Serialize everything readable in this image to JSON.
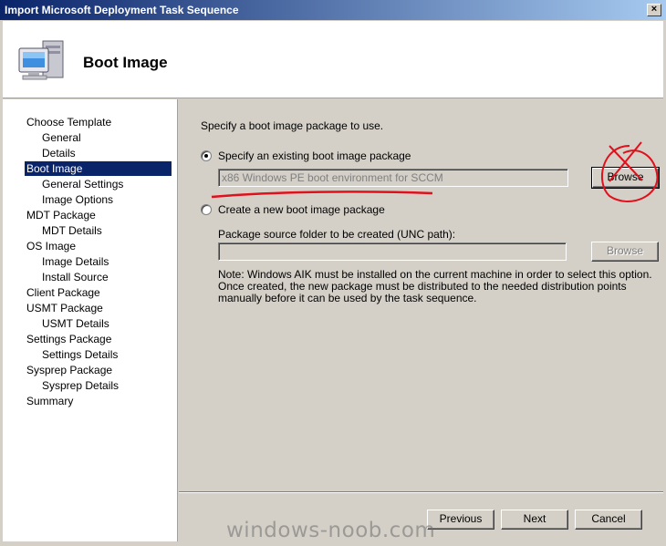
{
  "window": {
    "title": "Import Microsoft Deployment Task Sequence",
    "close_glyph": "×"
  },
  "header": {
    "title": "Boot Image",
    "icon": "computer-icon"
  },
  "nav": {
    "items": [
      {
        "label": "Choose Template",
        "level": 0
      },
      {
        "label": "General",
        "level": 1
      },
      {
        "label": "Details",
        "level": 1
      },
      {
        "label": "Boot Image",
        "level": 0,
        "selected": true
      },
      {
        "label": "General Settings",
        "level": 1
      },
      {
        "label": "Image Options",
        "level": 1
      },
      {
        "label": "MDT Package",
        "level": 0
      },
      {
        "label": "MDT Details",
        "level": 1
      },
      {
        "label": "OS Image",
        "level": 0
      },
      {
        "label": "Image Details",
        "level": 1
      },
      {
        "label": "Install Source",
        "level": 1
      },
      {
        "label": "Client Package",
        "level": 0
      },
      {
        "label": "USMT Package",
        "level": 0
      },
      {
        "label": "USMT Details",
        "level": 1
      },
      {
        "label": "Settings Package",
        "level": 0
      },
      {
        "label": "Settings Details",
        "level": 1
      },
      {
        "label": "Sysprep Package",
        "level": 0
      },
      {
        "label": "Sysprep Details",
        "level": 1
      },
      {
        "label": "Summary",
        "level": 0
      }
    ]
  },
  "content": {
    "prompt": "Specify a boot image package to use.",
    "option_existing": {
      "label": "Specify an existing boot image package",
      "checked": true
    },
    "existing_value": "x86 Windows PE boot environment for SCCM",
    "browse_existing": "Browse",
    "option_new": {
      "label": "Create a new boot image package",
      "checked": false
    },
    "source_folder_label": "Package source folder to be created (UNC path):",
    "source_folder_value": "",
    "browse_new": "Browse",
    "note": "Note: Windows AIK must be installed on the current machine in order to select this option.  Once created, the new package must be distributed to the needed distribution points manually before it can be used by the task sequence."
  },
  "footer": {
    "previous": "Previous",
    "next": "Next",
    "cancel": "Cancel"
  },
  "watermark": "windows-noob.com",
  "colors": {
    "title_start": "#0a246a",
    "title_end": "#a6caf0",
    "selection": "#0a246a",
    "annotation": "#e0101c"
  }
}
